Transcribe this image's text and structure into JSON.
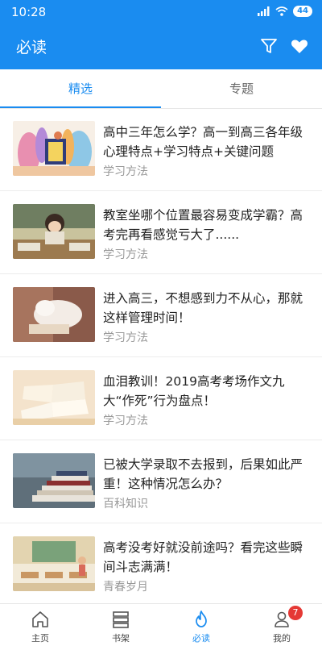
{
  "status": {
    "time": "10:28",
    "battery": "44"
  },
  "appbar": {
    "title": "必读"
  },
  "tabs": [
    {
      "label": "精选",
      "active": true
    },
    {
      "label": "专题",
      "active": false
    }
  ],
  "articles": [
    {
      "title": "高中三年怎么学？高一到高三各年级心理特点+学习特点+关键问题",
      "category": "学习方法"
    },
    {
      "title": "教室坐哪个位置最容易变成学霸？高考完再看感觉亏大了......",
      "category": "学习方法"
    },
    {
      "title": "进入高三，不想感到力不从心，那就这样管理时间！",
      "category": "学习方法"
    },
    {
      "title": "血泪教训！2019高考考场作文九大“作死”行为盘点！",
      "category": "学习方法"
    },
    {
      "title": "已被大学录取不去报到，后果如此严重！这种情况怎么办？",
      "category": "百科知识"
    },
    {
      "title": "高考没考好就没前途吗？看完这些瞬间斗志满满！",
      "category": "青春岁月"
    }
  ],
  "bottom_nav": [
    {
      "label": "主页",
      "icon": "home-icon"
    },
    {
      "label": "书架",
      "icon": "bookshelf-icon"
    },
    {
      "label": "必读",
      "icon": "flame-icon",
      "active": true
    },
    {
      "label": "我的",
      "icon": "user-icon",
      "badge": "7"
    }
  ],
  "colors": {
    "primary": "#1a8cf0",
    "badge": "#e53935"
  }
}
